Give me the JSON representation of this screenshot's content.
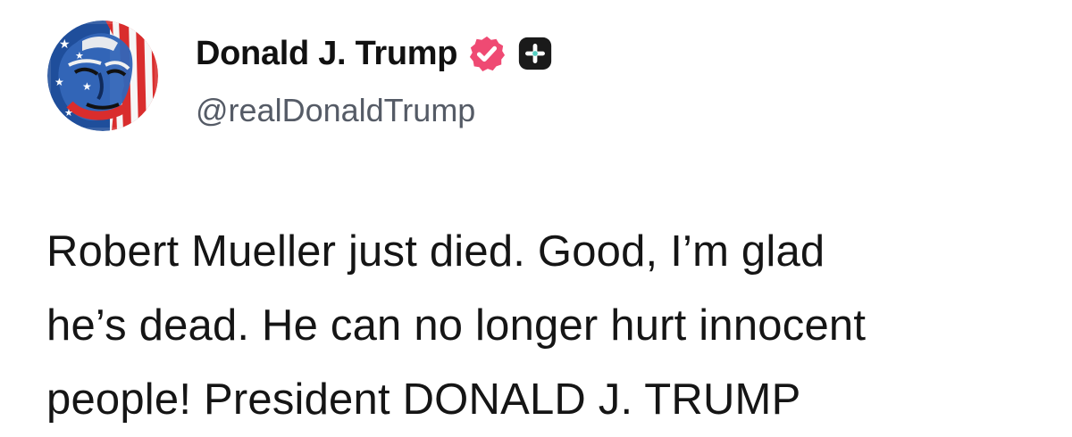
{
  "author": {
    "display_name": "Donald J. Trump",
    "handle": "@realDonaldTrump",
    "verified_icon": "verified-badge-icon",
    "verified_color": "#ef4a73",
    "extra_icon": "plus-square-icon",
    "extra_icon_color": "#1a1a1a"
  },
  "post": {
    "lines": [
      "Robert Mueller just died. Good, I’m glad",
      "he’s dead. He can no longer hurt innocent",
      "people! President DONALD J. TRUMP"
    ]
  },
  "colors": {
    "background": "#ffffff",
    "text": "#151515",
    "handle": "#555b66"
  }
}
